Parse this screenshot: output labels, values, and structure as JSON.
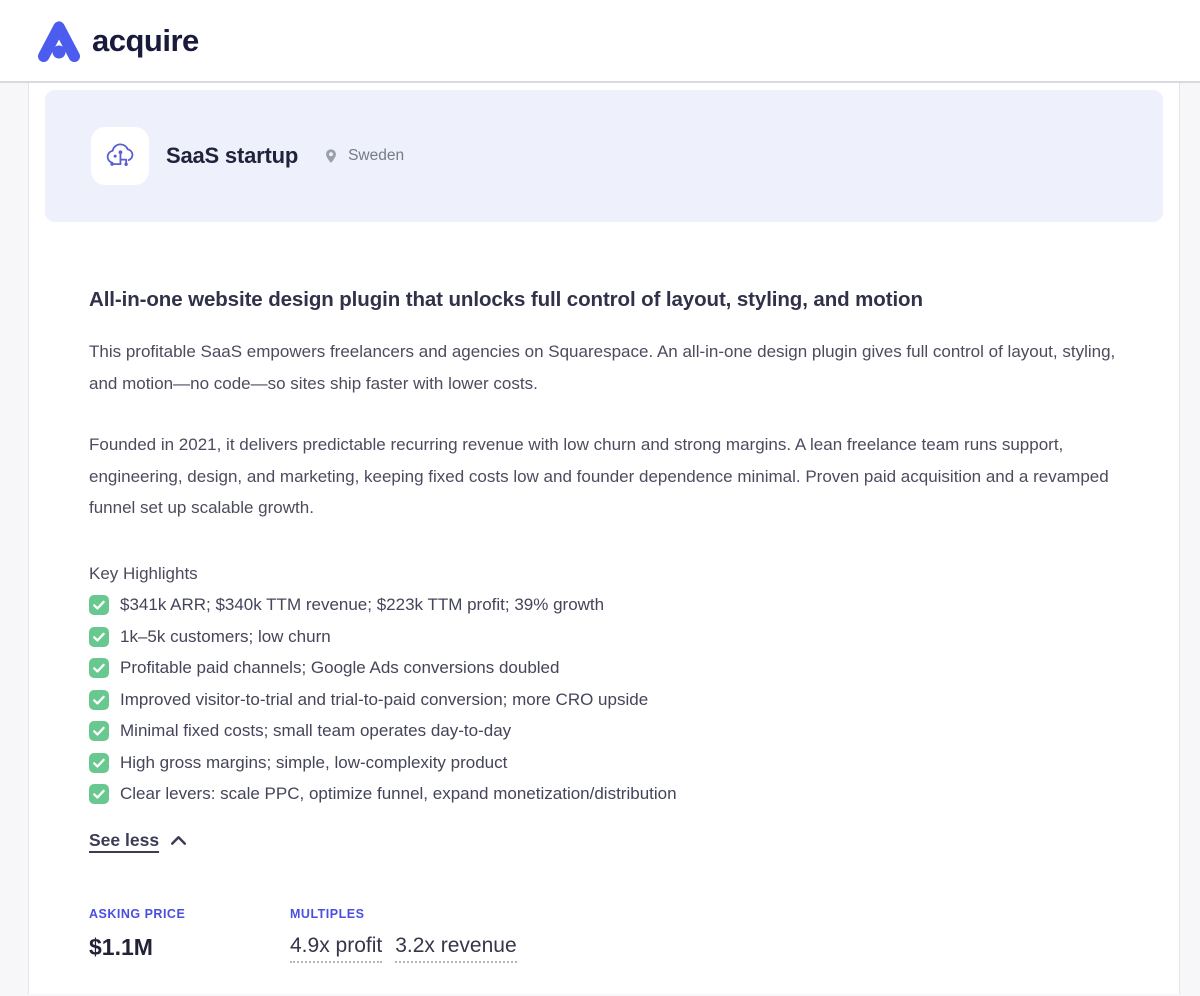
{
  "navbar": {
    "logo_text": "acquire"
  },
  "listing": {
    "header": {
      "title": "SaaS startup",
      "location": "Sweden"
    },
    "headline": "All-in-one website design plugin that unlocks full control of layout, styling, and motion",
    "paragraphs": [
      "This profitable SaaS empowers freelancers and agencies on Squarespace. An all-in-one design plugin gives full control of layout, styling, and motion—no code—so sites ship faster with lower costs.",
      "Founded in 2021, it delivers predictable recurring revenue with low churn and strong margins. A lean freelance team runs support, engineering, design, and marketing, keeping fixed costs low and founder dependence minimal. Proven paid acquisition and a revamped funnel set up scalable growth."
    ],
    "highlights_title": "Key Highlights",
    "highlights": [
      "$341k ARR; $340k TTM revenue; $223k TTM profit; 39% growth",
      "1k–5k customers; low churn",
      "Profitable paid channels; Google Ads conversions doubled",
      "Improved visitor-to-trial and trial-to-paid conversion; more CRO upside",
      "Minimal fixed costs; small team operates day-to-day",
      "High gross margins; simple, low-complexity product",
      "Clear levers: scale PPC, optimize funnel, expand monetization/distribution"
    ],
    "see_less_label": "See less",
    "asking_price": {
      "label": "ASKING PRICE",
      "value": "$1.1M"
    },
    "multiples": {
      "label": "MULTIPLES",
      "values": [
        "4.9x profit",
        "3.2x revenue"
      ]
    }
  },
  "icons": {
    "logo_mark": "acquire-triangle-mark",
    "listing_avatar": "cloud-circuit-icon",
    "location": "map-pin-icon",
    "highlight_bullet": "green-check-icon",
    "see_less": "chevron-up-icon"
  },
  "colors": {
    "brand_blue": "#4b5cee",
    "accent_label_blue": "#4a4fdf",
    "check_green": "#69c88f",
    "header_card_bg": "#eef0fb",
    "text_dark": "#232338",
    "text_body": "#4b4c5e",
    "location_gray": "#767b85"
  }
}
